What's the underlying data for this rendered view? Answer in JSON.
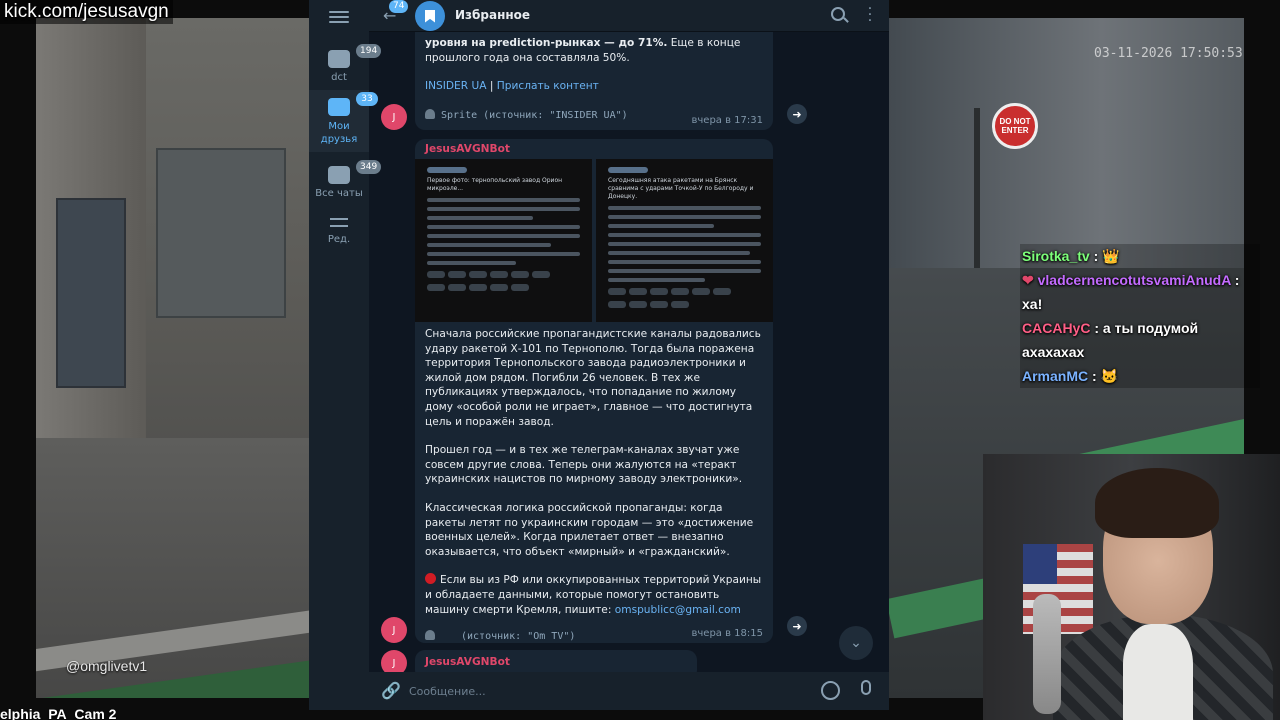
{
  "stream": {
    "channel_url": "kick.com/jesusavgn",
    "bottom_label": "elphia_PA_Cam 2",
    "left_cam_watermark": "@omglivetv1",
    "right_cam_timestamp": "03-11-2026 17:50:53",
    "sign_text_1": "DO NOT",
    "sign_text_2": "ENTER"
  },
  "chat_overlay": [
    {
      "user": "Sirotka_tv",
      "sep": " : ",
      "text": ""
    },
    {
      "user": "vladcernencotutsvamiAnudA",
      "sep": " :",
      "text": ""
    },
    {
      "user": "",
      "sep": "",
      "text": "ха!"
    },
    {
      "user": "CACAHyC",
      "sep": " : ",
      "text": "а ты подумой"
    },
    {
      "user": "",
      "sep": "",
      "text": "ахахахах"
    },
    {
      "user": "ArmanMC",
      "sep": " : ",
      "text": ""
    }
  ],
  "colors": {
    "chat_user_2": "#c46bff",
    "chat_user_4": "#ff5e86",
    "chat_user_6": "#7ab2ff",
    "chat_user_1": "#7dff7a",
    "accent": "#5eb5f7",
    "sender": "#e0476a"
  },
  "telegram": {
    "header": {
      "title": "Избранное",
      "back_count": "74"
    },
    "sidebar": {
      "folders": [
        {
          "label": "dct",
          "badge": "194",
          "icon": "chat-bubble-icon"
        },
        {
          "label": "Мои друзья",
          "badge": "33",
          "icon": "chat-bubble-icon",
          "active": true
        },
        {
          "label": "Все чаты",
          "badge": "349",
          "icon": "chat-bubbles-icon"
        },
        {
          "label": "Ред.",
          "badge": "",
          "icon": "sliders-icon"
        }
      ]
    },
    "messages": {
      "first": {
        "text_bold": "уровня на prediction-рынках — до 71%.",
        "text_rest": " Еще в конце прошлого года она составляла 50%.",
        "link_1": "INSIDER UA",
        "link_sep": " | ",
        "link_2": "Прислать контент",
        "source_line": "Sprite (источник: \"INSIDER UA\")",
        "time": "вчера в 17:31"
      },
      "second": {
        "sender": "JesusAVGNBot",
        "paragraph_1": "Сначала российские пропагандистские каналы радовались удару ракетой Х-101 по Тернополю. Тогда была поражена территория Тернопольского завода радиоэлектроники и жилой дом рядом. Погибли 26 человек. В тех же публикациях утверждалось, что попадание по жилому дому «особой роли не играет», главное — что достигнута цель и поражён завод.",
        "paragraph_2": "Прошел год — и в тех же телеграм-каналах звучат уже совсем другие слова. Теперь они жалуются на «теракт украинских нацистов по мирному заводу электроники».",
        "paragraph_3": "Классическая логика российской пропаганды: когда ракеты летят по украинским городам — это «достижение военных целей». Когда прилетает ответ — внезапно оказывается, что объект «мирный» и «гражданский».",
        "paragraph_4": "Если вы из РФ или оккупированных территорий Украины и обладаете данными, которые помогут остановить машину смерти Кремля, пишите: ",
        "email": "omspublicc@gmail.com",
        "source_line": "(источник: \"Om TV\")",
        "time": "вчера в 18:15",
        "photo_1_title": "Первое фото: тернопольский завод Орион микроэле...",
        "photo_2_title": "Сегодняшняя атака ракетами на Брянск сравнима с ударами Точкой-У по Белгороду и Донецку."
      },
      "third": {
        "sender": "JesusAVGNBot"
      }
    },
    "avatar_letter": "J",
    "composer": {
      "placeholder": "Сообщение..."
    }
  }
}
